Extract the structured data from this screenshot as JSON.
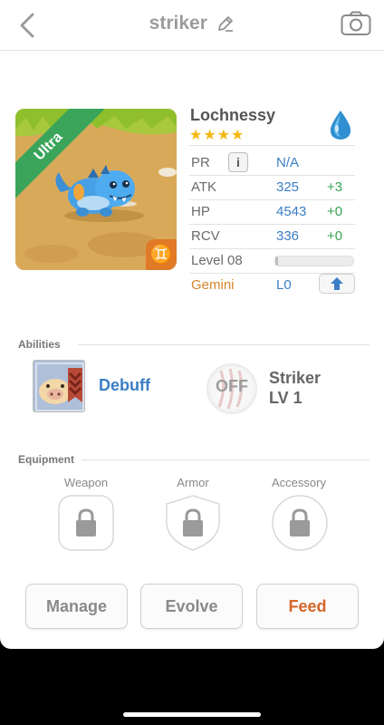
{
  "header": {
    "title": "striker"
  },
  "pet": {
    "rarity": "Ultra",
    "name": "Lochnessy",
    "stars": "★★★★",
    "zodiac_symbol": "♊"
  },
  "stats": {
    "pr": {
      "label": "PR",
      "value": "N/A",
      "info": "i"
    },
    "atk": {
      "label": "ATK",
      "value": "325",
      "bonus": "+3"
    },
    "hp": {
      "label": "HP",
      "value": "4543",
      "bonus": "+0"
    },
    "rcv": {
      "label": "RCV",
      "value": "336",
      "bonus": "+0"
    },
    "level": {
      "label": "Level 08",
      "progress": 0.02
    },
    "zodiac": {
      "label": "Gemini",
      "value": "L0"
    }
  },
  "abilities": {
    "title": "Abilities",
    "ability1": {
      "name": "Debuff"
    },
    "ability2": {
      "status": "OFF",
      "name": "Striker",
      "level": "LV 1"
    }
  },
  "equipment": {
    "title": "Equipment",
    "slots": [
      {
        "label": "Weapon"
      },
      {
        "label": "Armor"
      },
      {
        "label": "Accessory"
      }
    ]
  },
  "actions": {
    "manage": "Manage",
    "evolve": "Evolve",
    "feed": "Feed"
  },
  "colors": {
    "accent_blue": "#3b7ec4",
    "bonus_green": "#38a456",
    "feed_orange": "#d5662a",
    "ribbon_green": "#3aa55a",
    "star_gold": "#f3b812"
  }
}
